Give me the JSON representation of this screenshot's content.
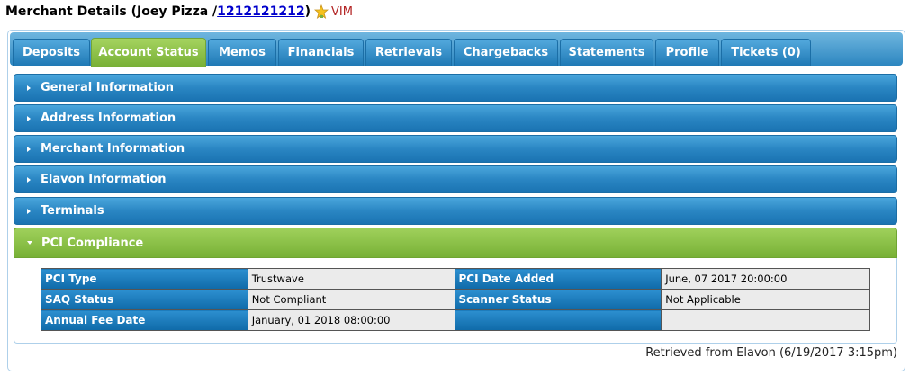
{
  "header": {
    "title_prefix": "Merchant Details (Joey Pizza /",
    "merchant_id": "1212121212",
    "title_suffix": ")",
    "vim_label": "VIM"
  },
  "tabs": [
    {
      "label": "Deposits"
    },
    {
      "label": "Account Status",
      "active": true
    },
    {
      "label": "Memos"
    },
    {
      "label": "Financials"
    },
    {
      "label": "Retrievals"
    },
    {
      "label": "Chargebacks"
    },
    {
      "label": "Statements"
    },
    {
      "label": "Profile"
    },
    {
      "label": "Tickets (0)"
    }
  ],
  "sections": [
    {
      "label": "General Information",
      "open": false
    },
    {
      "label": "Address Information",
      "open": false
    },
    {
      "label": "Merchant Information",
      "open": false
    },
    {
      "label": "Elavon Information",
      "open": false
    },
    {
      "label": "Terminals",
      "open": false
    },
    {
      "label": "PCI Compliance",
      "open": true
    }
  ],
  "pci": {
    "rows": [
      {
        "label1": "PCI Type",
        "value1": "Trustwave",
        "label2": "PCI Date Added",
        "value2": "June, 07 2017 20:00:00"
      },
      {
        "label1": "SAQ Status",
        "value1": "Not Compliant",
        "label2": "Scanner Status",
        "value2": "Not Applicable"
      },
      {
        "label1": "Annual Fee Date",
        "value1": "January, 01 2018 08:00:00",
        "label2": "",
        "value2": ""
      }
    ]
  },
  "footer": {
    "retrieved": "Retrieved from Elavon (6/19/2017 3:15pm)"
  },
  "colors": {
    "tab_blue": "#2c86c0",
    "active_green": "#78b036",
    "link": "#0000cc",
    "vim_red": "#b22222"
  }
}
